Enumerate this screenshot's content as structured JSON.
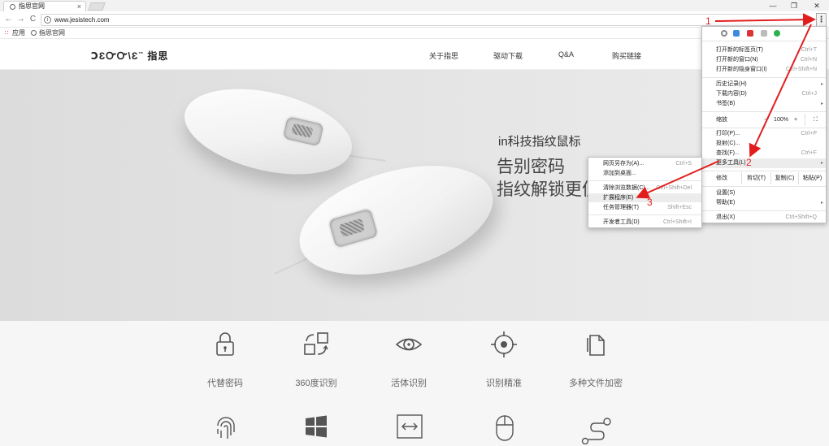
{
  "browser": {
    "tab_title": "指思官网",
    "tab_close": "×",
    "window_controls": {
      "minimize": "—",
      "maximize": "❐",
      "close": "✕"
    },
    "url": "www.jesistech.com",
    "nav": {
      "back": "←",
      "forward": "→",
      "reload": "C"
    },
    "kebab": "⋮",
    "bookmarks": [
      "应用",
      "指思官网"
    ]
  },
  "site": {
    "logo_text": "ↃƐᏅᏅ\\Ɛ",
    "logo_tm": "™",
    "logo_cn": "指思",
    "nav": [
      "关于指思",
      "驱动下载",
      "Q&A",
      "购买链接"
    ],
    "hero": {
      "kicker": "in科技指纹鼠标",
      "line1": "告别密码",
      "line2": "指纹解锁更便"
    },
    "features_row1": [
      "代替密码",
      "360度识别",
      "活体识别",
      "识别精准",
      "多种文件加密"
    ],
    "features_row2_icons": [
      "fingerprint-icon",
      "windows-icon",
      "resize-icon",
      "mouse-icon",
      "share-path-icon"
    ]
  },
  "menu": {
    "items_group1": [
      {
        "label": "打开新的标签页(T)",
        "shortcut": "Ctrl+T"
      },
      {
        "label": "打开新的窗口(N)",
        "shortcut": "Ctrl+N"
      },
      {
        "label": "打开新的隐身窗口(I)",
        "shortcut": "Ctrl+Shift+N"
      }
    ],
    "items_group2": [
      {
        "label": "历史记录(H)",
        "shortcut": ""
      },
      {
        "label": "下载内容(D)",
        "shortcut": "Ctrl+J"
      },
      {
        "label": "书签(B)",
        "shortcut": ""
      }
    ],
    "zoom_label": "缩放",
    "zoom_minus": "－",
    "zoom_value": "100%",
    "zoom_plus": "+",
    "zoom_fullscreen": "⛶",
    "items_group3": [
      {
        "label": "打印(P)...",
        "shortcut": "Ctrl+P"
      },
      {
        "label": "投射(C)...",
        "shortcut": ""
      },
      {
        "label": "查找(F)...",
        "shortcut": "Ctrl+F"
      },
      {
        "label": "更多工具(L)",
        "shortcut": ""
      }
    ],
    "edit_label": "修改",
    "cut_label": "剪切(T)",
    "copy_label": "复制(C)",
    "paste_label": "粘贴(P)",
    "items_group4": [
      {
        "label": "设置(S)",
        "shortcut": ""
      },
      {
        "label": "帮助(E)",
        "shortcut": ""
      }
    ],
    "exit": {
      "label": "退出(X)",
      "shortcut": "Ctrl+Shift+Q"
    },
    "submenu_arrow": "▸"
  },
  "submenu": {
    "items": [
      {
        "label": "网页另存为(A)...",
        "shortcut": "Ctrl+S"
      },
      {
        "label": "添加到桌面...",
        "shortcut": ""
      },
      {
        "label": "清除浏览数据(C)...",
        "shortcut": "Ctrl+Shift+Del"
      },
      {
        "label": "扩展程序(E)",
        "shortcut": ""
      },
      {
        "label": "任务管理器(T)",
        "shortcut": "Shift+Esc"
      },
      {
        "label": "开发者工具(D)",
        "shortcut": "Ctrl+Shift+I"
      }
    ]
  },
  "annotations": {
    "n1": "1",
    "n2": "2",
    "n3": "3",
    "color": "#e21d1d"
  }
}
